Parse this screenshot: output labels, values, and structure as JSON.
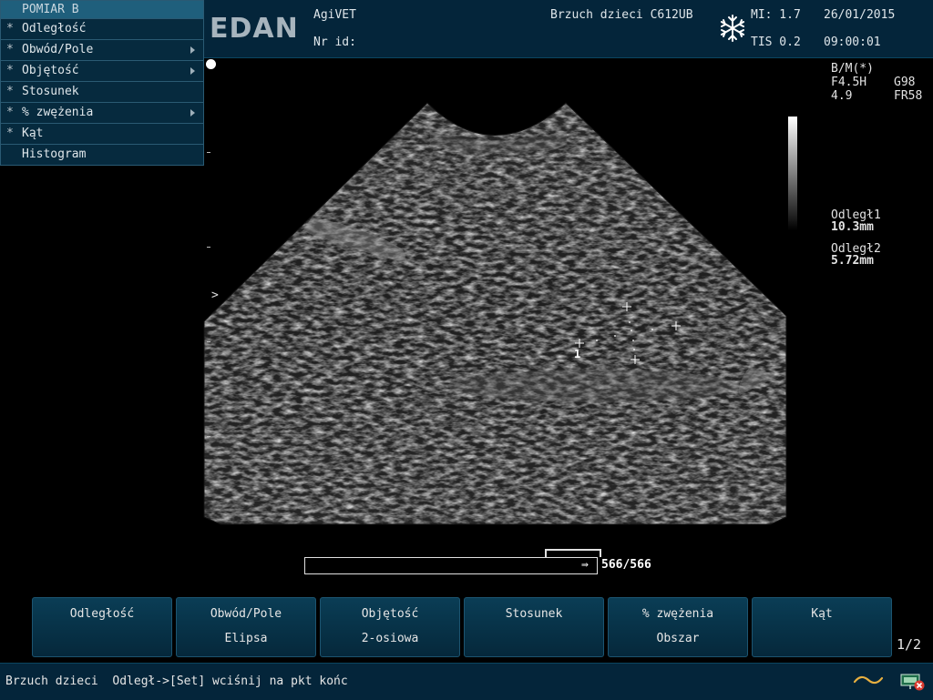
{
  "header": {
    "logo": "EDAN",
    "institution": "AgiVET",
    "id_label": "Nr id:",
    "preset": "Brzuch dzieci C612UB",
    "mi": "MI: 1.7",
    "tis": "TIS 0.2",
    "date": "26/01/2015",
    "time": "09:00:01"
  },
  "menu": {
    "title": "POMIAR B",
    "items": [
      {
        "label": "Odległość",
        "star": "*",
        "submenu": false
      },
      {
        "label": "Obwód/Pole",
        "star": "*",
        "submenu": true
      },
      {
        "label": "Objętość",
        "star": "*",
        "submenu": true
      },
      {
        "label": "Stosunek",
        "star": "*",
        "submenu": false
      },
      {
        "label": "% zwężenia",
        "star": "*",
        "submenu": true
      },
      {
        "label": "Kąt",
        "star": "*",
        "submenu": false
      },
      {
        "label": "Histogram",
        "star": "",
        "submenu": false
      }
    ]
  },
  "image_params": {
    "mode": "B/M(*)",
    "freq": "F4.5H",
    "gain": "G98",
    "depth": "4.9",
    "frame_rate": "FR58"
  },
  "measurements": [
    {
      "label": "Odległ1",
      "value": "10.3mm"
    },
    {
      "label": "Odległ2",
      "value": "5.72mm"
    }
  ],
  "caliper_label": "1",
  "cine": {
    "frames": "566/566",
    "arrow": "⇛"
  },
  "softkeys": [
    {
      "line1": "Odległość",
      "line2": ""
    },
    {
      "line1": "Obwód/Pole",
      "line2": "Elipsa"
    },
    {
      "line1": "Objętość",
      "line2": "2-osiowa"
    },
    {
      "line1": "Stosunek",
      "line2": ""
    },
    {
      "line1": "% zwężenia",
      "line2": "Obszar"
    },
    {
      "line1": "Kąt",
      "line2": ""
    }
  ],
  "page_indicator": "1/2",
  "status": {
    "text": "Brzuch dzieci  Odległ->[Set] wciśnij na pkt końc"
  },
  "icons": {
    "freeze": "snowflake-icon",
    "wave": "wave-icon",
    "network": "network-error-icon",
    "focus": "focus-marker-icon"
  },
  "colors": {
    "panel": "#04253a",
    "accent": "#1f5f7c",
    "wave": "#e8b040",
    "error": "#d93a2f"
  }
}
